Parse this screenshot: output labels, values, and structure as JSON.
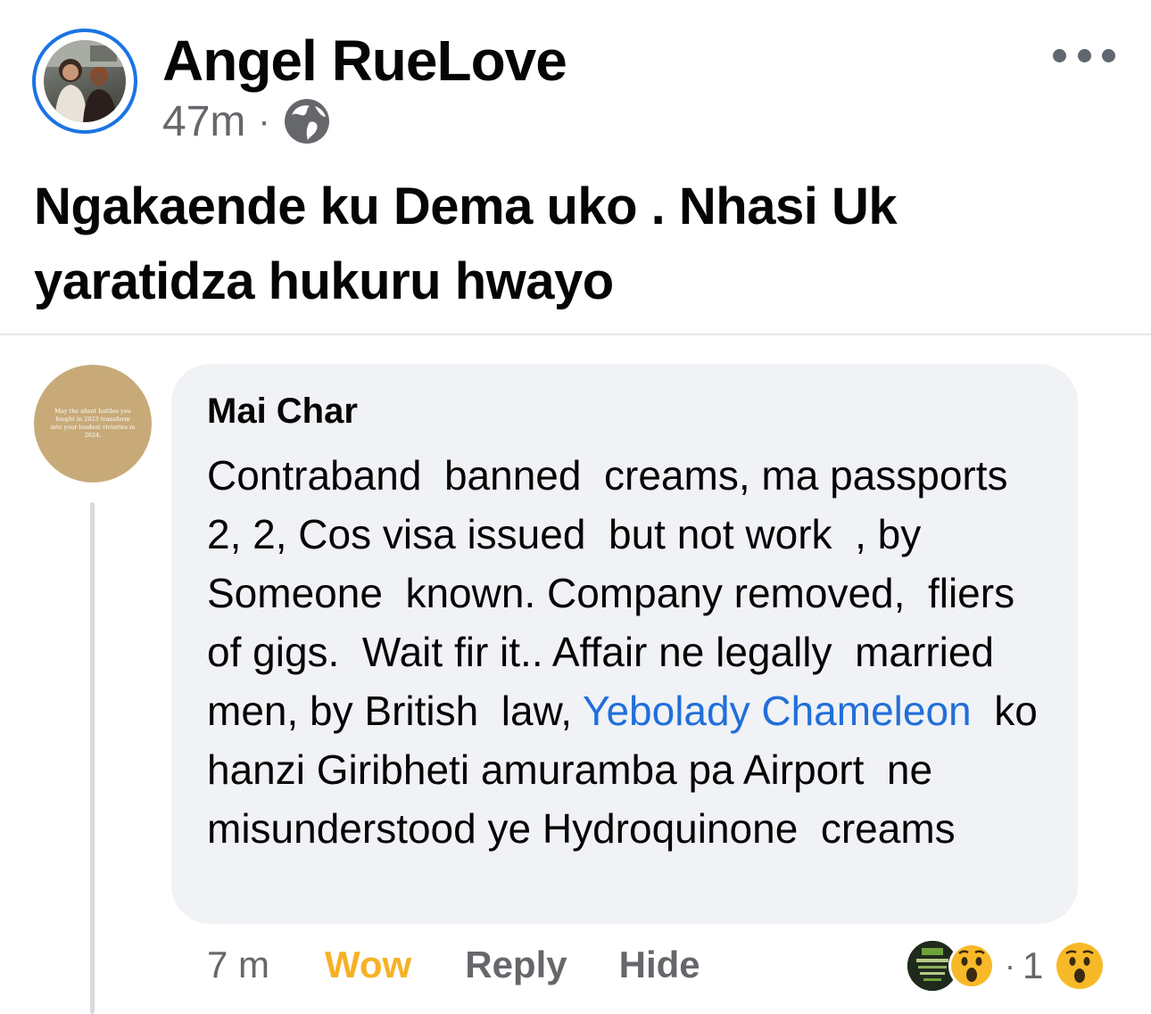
{
  "post": {
    "author": "Angel RueLove",
    "time": "47m",
    "separator": "·",
    "visibility_icon": "globe-icon",
    "more_icon": "more-options-icon",
    "text": "Ngakaende ku Dema uko . Nhasi Uk yaratidza hukuru hwayo"
  },
  "comment": {
    "author": "Mai Char",
    "avatar_quote": "May the silent battles you fought in 2023 transform into your loudest victories in 2024.",
    "text_before": "Contraband  banned  creams, ma passports 2, 2, Cos visa issued  but not work  , by Someone  known. Company removed,  fliers  of gigs.  Wait fir it.. Affair ne legally  married  men, by British  law, ",
    "mention": "Yebolady Chameleon",
    "text_after": "  ko hanzi Giribheti amuramba pa Airport  ne misunderstood ye Hydroquinone  creams",
    "time": "7 m",
    "reaction_label": "Wow",
    "reply_label": "Reply",
    "hide_label": "Hide",
    "reaction_separator": "·",
    "reaction_count": "1",
    "reaction_icons": [
      "wow-face-icon"
    ]
  },
  "colors": {
    "accent": "#1b74e4",
    "mention": "#216fdb",
    "wow": "#f7b125",
    "secondary_text": "#65676b",
    "bubble": "#f0f2f5"
  }
}
